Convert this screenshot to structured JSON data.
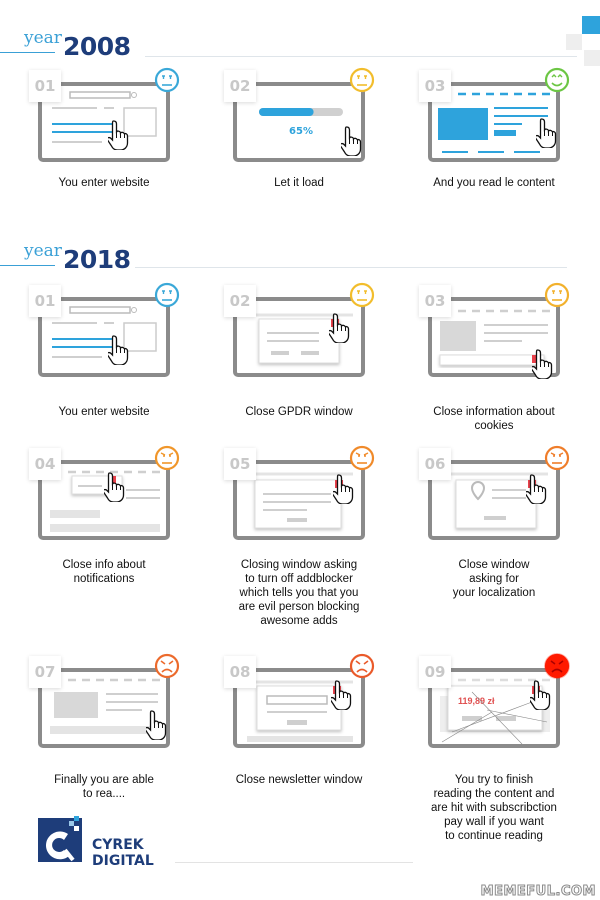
{
  "colors": {
    "blue": "#2ea3dc",
    "dark_blue": "#1e3d7a",
    "frame": "#8b8b8b",
    "red_btn": "#e8414b"
  },
  "sections": [
    {
      "year_label": "year",
      "year": "2008",
      "cards": [
        {
          "num": "01",
          "caption": "You enter website",
          "illus": "enter",
          "mood": "neutral",
          "emoji_color": "#3aa8d8"
        },
        {
          "num": "02",
          "caption": "Let it load",
          "illus": "load",
          "progress": 65,
          "progress_label": "65%",
          "mood": "neutral",
          "emoji_color": "#f2bd2c"
        },
        {
          "num": "03",
          "caption": "And you read le content",
          "illus": "read",
          "mood": "happy",
          "emoji_color": "#6cc644"
        }
      ]
    },
    {
      "year_label": "year",
      "year": "2018",
      "cards": [
        {
          "num": "01",
          "caption": "You enter website",
          "illus": "enter",
          "mood": "neutral",
          "emoji_color": "#3aa8d8"
        },
        {
          "num": "02",
          "caption": "Close GPDR window",
          "illus": "popup",
          "mood": "neutral",
          "emoji_color": "#f2bd2c"
        },
        {
          "num": "03",
          "caption": "Close information about\ncookies",
          "illus": "cookies",
          "mood": "neutral",
          "emoji_color": "#f2b12c"
        },
        {
          "num": "04",
          "caption": "Close info about\nnotifications",
          "illus": "notif",
          "mood": "annoyed",
          "emoji_color": "#f0962a"
        },
        {
          "num": "05",
          "caption": "Closing window asking\nto turn off addblocker\nwhich tells you that you\nare evil person blocking\nawesome adds",
          "illus": "popup2",
          "mood": "annoyed",
          "emoji_color": "#f08a2a"
        },
        {
          "num": "06",
          "caption": "Close window\nasking for\nyour localization",
          "illus": "location",
          "mood": "annoyed",
          "emoji_color": "#ef7d2a"
        },
        {
          "num": "07",
          "caption": "Finally you are able\nto rea....",
          "illus": "finally",
          "mood": "angry",
          "emoji_color": "#ec6a2c"
        },
        {
          "num": "08",
          "caption": "Close newsletter window",
          "illus": "newsletter",
          "mood": "angry",
          "emoji_color": "#ea5a2a"
        },
        {
          "num": "09",
          "caption": "You try to finish\nreading the content and\nare hit with subscribction\npay wall if you want\nto continue reading",
          "illus": "paywall",
          "price": "119,89 zł",
          "mood": "furious",
          "emoji_color": "#ff1a00"
        }
      ]
    }
  ],
  "logo": {
    "line1": "CYREK",
    "line2": "DIGITAL"
  },
  "watermark": "MEMEFUL.COM"
}
